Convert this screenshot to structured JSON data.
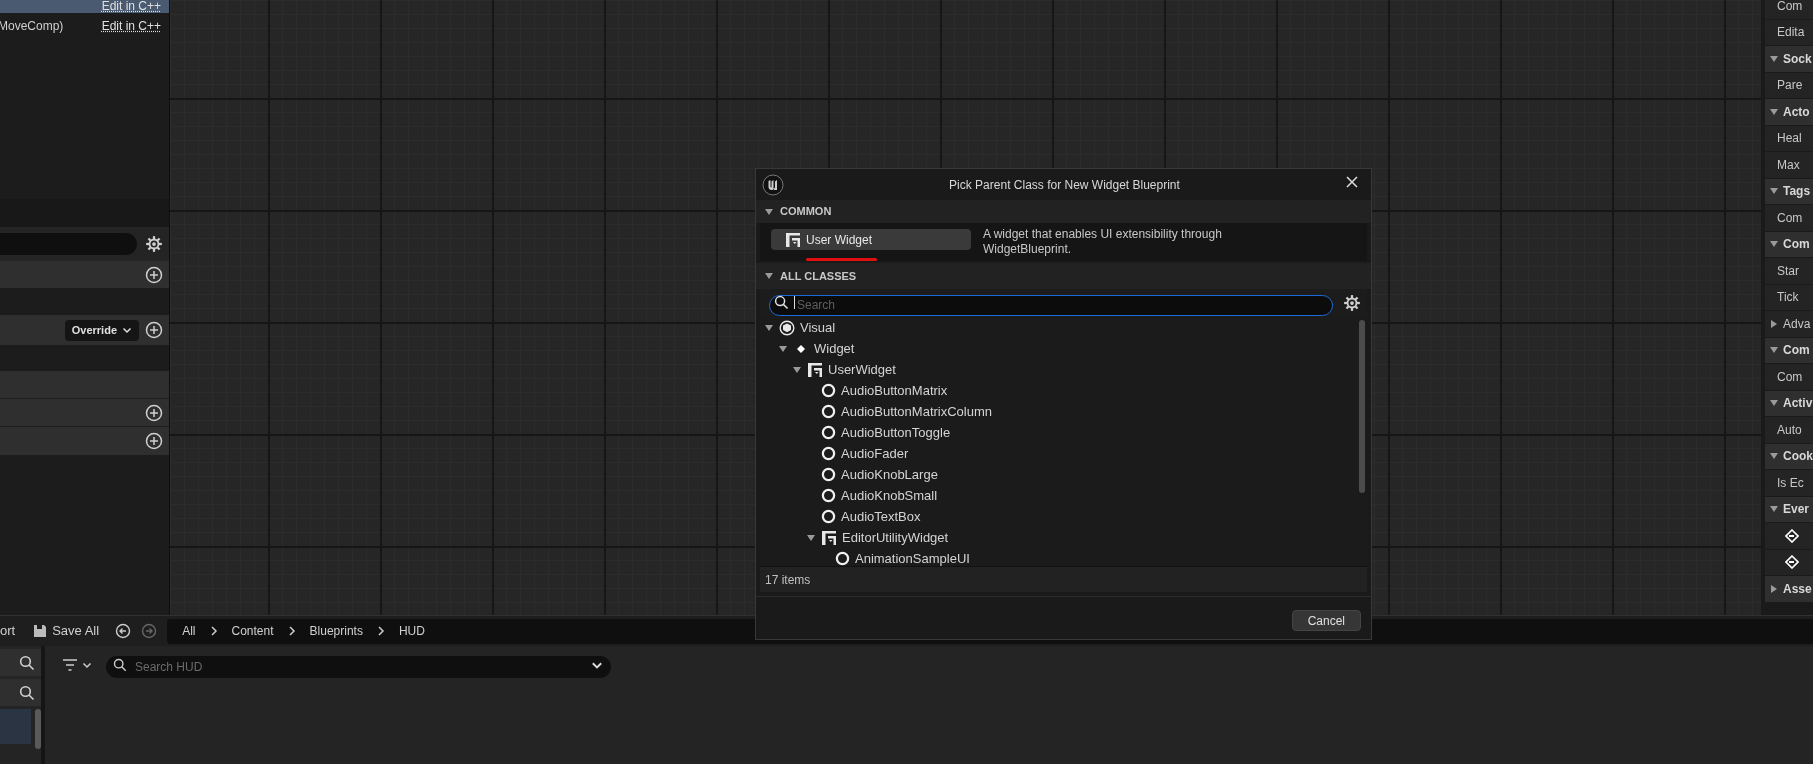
{
  "left_panel": {
    "rows": [
      {
        "link": "Edit in C++",
        "selected": true
      },
      {
        "label": "MoveComp)",
        "link": "Edit in C++",
        "selected": false
      }
    ],
    "override": "Override"
  },
  "right_panel": {
    "rows": [
      {
        "kind": "row",
        "label": "Com"
      },
      {
        "kind": "row",
        "label": "Edita"
      },
      {
        "kind": "header",
        "label": "Sock",
        "expanded": true
      },
      {
        "kind": "row",
        "label": "Pare"
      },
      {
        "kind": "header",
        "label": "Acto",
        "expanded": true
      },
      {
        "kind": "row",
        "label": "Heal"
      },
      {
        "kind": "row",
        "label": "Max"
      },
      {
        "kind": "header",
        "label": "Tags",
        "expanded": true
      },
      {
        "kind": "row",
        "label": "Com"
      },
      {
        "kind": "header",
        "label": "Com",
        "expanded": true
      },
      {
        "kind": "row",
        "label": "Star"
      },
      {
        "kind": "row",
        "label": "Tick"
      },
      {
        "kind": "sub",
        "label": "Adva",
        "expanded": false
      },
      {
        "kind": "header",
        "label": "Com",
        "expanded": true
      },
      {
        "kind": "row",
        "label": "Com"
      },
      {
        "kind": "header",
        "label": "Activ",
        "expanded": true
      },
      {
        "kind": "row",
        "label": "Auto"
      },
      {
        "kind": "header",
        "label": "Cook",
        "expanded": true
      },
      {
        "kind": "row",
        "label": "Is Ec"
      },
      {
        "kind": "header",
        "label": "Ever",
        "expanded": true
      },
      {
        "kind": "event"
      },
      {
        "kind": "event"
      },
      {
        "kind": "header",
        "label": "Asse",
        "expanded": false
      }
    ]
  },
  "dialog": {
    "title": "Pick Parent Class for New Widget Blueprint",
    "common": {
      "label": "COMMON",
      "expanded": true,
      "button": "User Widget",
      "description": "A widget that enables UI extensibility through WidgetBlueprint."
    },
    "all_classes": {
      "label": "ALL CLASSES",
      "expanded": true,
      "placeholder": "Search",
      "tree": [
        {
          "kind": "cube",
          "label": "Visual",
          "expanded": true,
          "children": [
            {
              "kind": "dot",
              "label": "Widget",
              "expanded": true,
              "children": [
                {
                  "kind": "widget",
                  "label": "UserWidget",
                  "expanded": true,
                  "children": [
                    {
                      "kind": "circle",
                      "label": "AudioButtonMatrix"
                    },
                    {
                      "kind": "circle",
                      "label": "AudioButtonMatrixColumn"
                    },
                    {
                      "kind": "circle",
                      "label": "AudioButtonToggle"
                    },
                    {
                      "kind": "circle",
                      "label": "AudioFader"
                    },
                    {
                      "kind": "circle",
                      "label": "AudioKnobLarge"
                    },
                    {
                      "kind": "circle",
                      "label": "AudioKnobSmall"
                    },
                    {
                      "kind": "circle",
                      "label": "AudioTextBox"
                    },
                    {
                      "kind": "widget",
                      "label": "EditorUtilityWidget",
                      "expanded": true,
                      "children": [
                        {
                          "kind": "circle",
                          "label": "AnimationSampleUI"
                        }
                      ]
                    }
                  ]
                }
              ]
            }
          ]
        }
      ],
      "count": "17 items"
    },
    "cancel": "Cancel"
  },
  "content_bar": {
    "export": "ort",
    "save_all": "Save All",
    "breadcrumbs": [
      "All",
      "Content",
      "Blueprints",
      "HUD"
    ],
    "search_placeholder": "Search HUD"
  }
}
